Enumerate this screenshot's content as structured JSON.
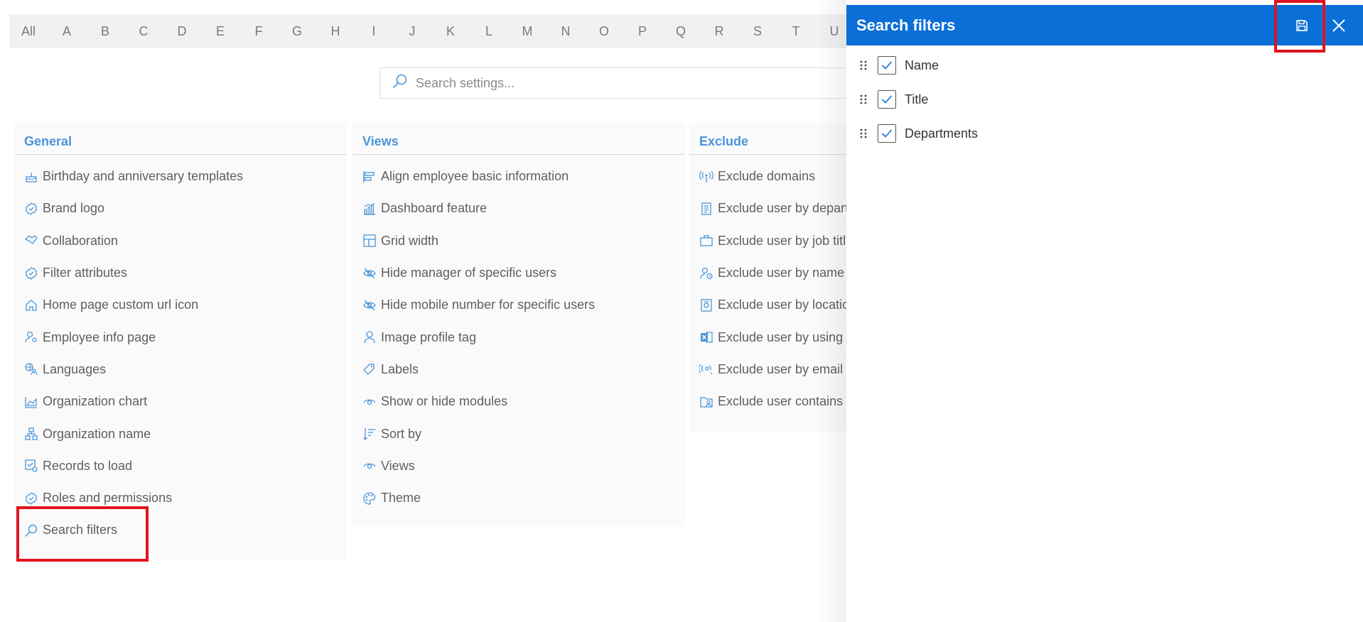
{
  "alphabet": [
    "All",
    "A",
    "B",
    "C",
    "D",
    "E",
    "F",
    "G",
    "H",
    "I",
    "J",
    "K",
    "L",
    "M",
    "N",
    "O",
    "P",
    "Q",
    "R",
    "S",
    "T",
    "U"
  ],
  "search": {
    "placeholder": "Search settings..."
  },
  "columns": {
    "general": {
      "title": "General",
      "items": [
        {
          "label": "Birthday and anniversary templates",
          "icon": "cake-icon"
        },
        {
          "label": "Brand logo",
          "icon": "badge-check-icon"
        },
        {
          "label": "Collaboration",
          "icon": "handshake-icon"
        },
        {
          "label": "Filter attributes",
          "icon": "badge-check-icon"
        },
        {
          "label": "Home page custom url icon",
          "icon": "home-icon"
        },
        {
          "label": "Employee info page",
          "icon": "person-settings-icon"
        },
        {
          "label": "Languages",
          "icon": "globe-people-icon"
        },
        {
          "label": "Organization chart",
          "icon": "area-chart-icon"
        },
        {
          "label": "Organization name",
          "icon": "org-tree-icon"
        },
        {
          "label": "Records to load",
          "icon": "checklist-gear-icon"
        },
        {
          "label": "Roles and permissions",
          "icon": "badge-check-icon"
        },
        {
          "label": "Search filters",
          "icon": "search-icon"
        }
      ]
    },
    "views": {
      "title": "Views",
      "items": [
        {
          "label": "Align employee basic information",
          "icon": "align-left-icon"
        },
        {
          "label": "Dashboard feature",
          "icon": "dashboard-chart-icon"
        },
        {
          "label": "Grid width",
          "icon": "grid-layout-icon"
        },
        {
          "label": "Hide manager of specific users",
          "icon": "eye-off-icon"
        },
        {
          "label": "Hide mobile number for specific users",
          "icon": "eye-off-icon"
        },
        {
          "label": "Image profile tag",
          "icon": "person-icon"
        },
        {
          "label": "Labels",
          "icon": "tag-icon"
        },
        {
          "label": "Show or hide modules",
          "icon": "eye-icon"
        },
        {
          "label": "Sort by",
          "icon": "sort-icon"
        },
        {
          "label": "Views",
          "icon": "eye-icon"
        },
        {
          "label": "Theme",
          "icon": "palette-icon"
        }
      ]
    },
    "exclude": {
      "title": "Exclude",
      "items": [
        {
          "label": "Exclude domains",
          "icon": "broadcast-icon"
        },
        {
          "label": "Exclude user by departments",
          "icon": "document-icon"
        },
        {
          "label": "Exclude user by job titles",
          "icon": "briefcase-icon"
        },
        {
          "label": "Exclude user by name",
          "icon": "person-clock-icon"
        },
        {
          "label": "Exclude user by location",
          "icon": "location-doc-icon"
        },
        {
          "label": "Exclude user by using excel",
          "icon": "excel-icon"
        },
        {
          "label": "Exclude user by email",
          "icon": "email-broadcast-icon"
        },
        {
          "label": "Exclude user contains",
          "icon": "folder-person-icon"
        }
      ]
    }
  },
  "panel": {
    "title": "Search filters",
    "save_icon": "save-icon",
    "close_icon": "close-icon",
    "filters": [
      {
        "label": "Name",
        "checked": true
      },
      {
        "label": "Title",
        "checked": true
      },
      {
        "label": "Departments",
        "checked": true
      }
    ]
  },
  "colors": {
    "accent": "#0b6fd8",
    "header_text": "#4a95d9",
    "highlight": "#e0141e"
  }
}
